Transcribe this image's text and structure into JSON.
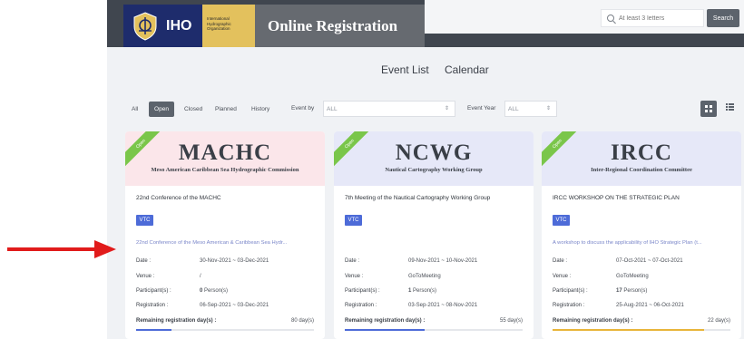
{
  "header": {
    "logo_text": "IHO",
    "org_lines": [
      "International",
      "Hydrographic",
      "Organization"
    ],
    "app_title": "Online Registration",
    "search_placeholder": "At least 3 letters",
    "search_button": "Search"
  },
  "tabs": [
    {
      "label": "Event List",
      "active": true
    },
    {
      "label": "Calendar",
      "active": false
    }
  ],
  "filters": {
    "status_buttons": [
      {
        "label": "All",
        "active": false
      },
      {
        "label": "Open",
        "active": true
      },
      {
        "label": "Closed",
        "active": false
      },
      {
        "label": "Planned",
        "active": false
      },
      {
        "label": "History",
        "active": false
      }
    ],
    "event_by_label": "Event by",
    "event_by_value": "ALL",
    "event_year_label": "Event Year",
    "event_year_value": "ALL",
    "caret": "⇕"
  },
  "field_labels": {
    "date": "Date :",
    "venue": "Venue :",
    "participants": "Participant(s) :",
    "registration": "Registration :",
    "remaining": "Remaining registration day(s) :"
  },
  "cards": [
    {
      "status": "Open",
      "acronym": "MACHC",
      "full_name": "Meso American Caribbean Sea Hydrographic Commission",
      "head_color": "#fbe6ea",
      "title": "22nd Conference of the MACHC",
      "badge": "VTC",
      "description": "22nd Conference of the Meso American & Caribbean Sea Hydr...",
      "date": "30-Nov-2021 ~ 03-Dec-2021",
      "venue": "/",
      "participants_count": "0",
      "participants_unit": "Person(s)",
      "registration": "06-Sep-2021 ~ 03-Dec-2021",
      "remaining": "80 day(s)",
      "progress": 0.2,
      "bar_color": "#4d6bd8"
    },
    {
      "status": "Open",
      "acronym": "NCWG",
      "full_name": "Nautical Cartography Working Group",
      "head_color": "#e6e8f8",
      "title": "7th Meeting of the Nautical Cartography Working Group",
      "badge": "VTC",
      "description": "",
      "date": "09-Nov-2021 ~ 10-Nov-2021",
      "venue": "GoToMeeting",
      "participants_count": "1",
      "participants_unit": "Person(s)",
      "registration": "03-Sep-2021 ~ 08-Nov-2021",
      "remaining": "55 day(s)",
      "progress": 0.45,
      "bar_color": "#4d6bd8"
    },
    {
      "status": "Open",
      "acronym": "IRCC",
      "full_name": "Inter-Regional Coordination Committee",
      "head_color": "#e6e8f8",
      "title": "IRCC WORKSHOP ON THE STRATEGIC PLAN",
      "badge": "VTC",
      "description": "A workshop to discuss the applicability of IHO Strategic Plan (t...",
      "date": "07-Oct-2021 ~ 07-Oct-2021",
      "venue": "GoToMeeting",
      "participants_count": "17",
      "participants_unit": "Person(s)",
      "registration": "25-Aug-2021 ~ 06-Oct-2021",
      "remaining": "22 day(s)",
      "progress": 0.85,
      "bar_color": "#e8b53a"
    }
  ],
  "colors": {
    "accent": "#5c636c",
    "ribbon": "#7ac64a",
    "badge": "#4d6bd8",
    "arrow": "#e11b1b"
  }
}
